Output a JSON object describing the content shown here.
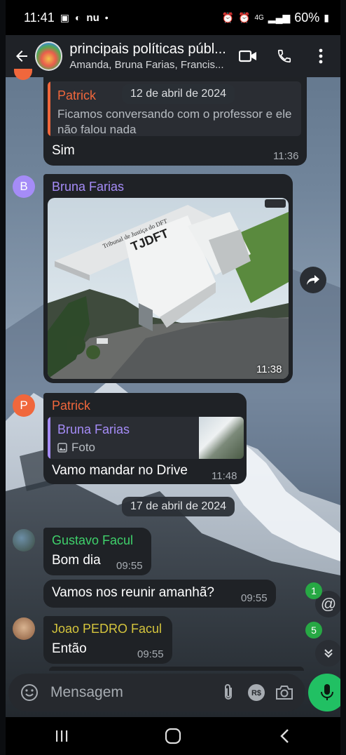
{
  "status": {
    "time": "11:41",
    "network": "4G",
    "battery": "60%",
    "carrier_icon": "nu"
  },
  "header": {
    "title": "principais políticas públ...",
    "subtitle": "Amanda, Bruna Farias, Francis..."
  },
  "dates": {
    "floating": "12 de abril de 2024",
    "second": "17 de abril de 2024"
  },
  "messages": [
    {
      "sender": "Patrick",
      "quote_text": "Ficamos conversando com o professor e ele não falou nada",
      "text": "Sim",
      "time": "11:36"
    },
    {
      "sender": "Bruna Farias",
      "avatar_letter": "B",
      "time": "11:38",
      "photo_sign": "Tribunal de Justiça do DFT",
      "photo_logo": "TJDFT"
    },
    {
      "sender": "Patrick",
      "avatar_letter": "P",
      "quote_sender": "Bruna Farias",
      "quote_type": "Foto",
      "text": "Vamo mandar no Drive",
      "time": "11:48"
    },
    {
      "sender": "Gustavo Facul",
      "text": "Bom dia",
      "time": "09:55"
    },
    {
      "text": "Vamos nos reunir amanhã?",
      "time": "09:55"
    },
    {
      "sender": "Joao PEDRO Facul",
      "text": "Então",
      "time": "09:55"
    }
  ],
  "badges": {
    "mentions": "1",
    "unread": "5"
  },
  "composer": {
    "placeholder": "Mensagem"
  },
  "colors": {
    "patrick": "#f0673c",
    "bruna": "#a58cf7",
    "gustavo": "#3fd16b",
    "joao": "#d5c53d",
    "accent_green": "#21c063"
  }
}
